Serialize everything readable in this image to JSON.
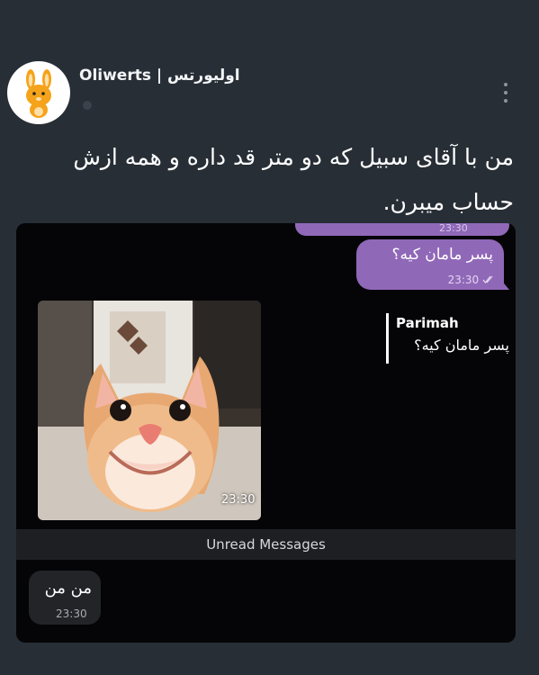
{
  "header": {
    "username": "Oliwerts | اولیورتس",
    "avatar_icon": "bunny-avatar-icon",
    "more_icon": "vertical-dots-icon"
  },
  "tweet": {
    "text": "من با آقای سبیل که دو متر قد داره و همه ازش حساب میبرن."
  },
  "chat": {
    "top_bubble_time": "23:30",
    "question_message": "پسر مامان کیه؟",
    "question_time": "23:30",
    "question_status_icon": "double-check-icon",
    "photo_time": "23:30",
    "reply_name": "Parimah",
    "reply_text": "پسر مامان کیه؟",
    "unread_label": "Unread Messages",
    "incoming_message": "من من",
    "incoming_time": "23:30"
  },
  "colors": {
    "background": "#272e36",
    "chat_background": "#050507",
    "outgoing_bubble": "#9068b8",
    "incoming_bubble": "#232428"
  }
}
